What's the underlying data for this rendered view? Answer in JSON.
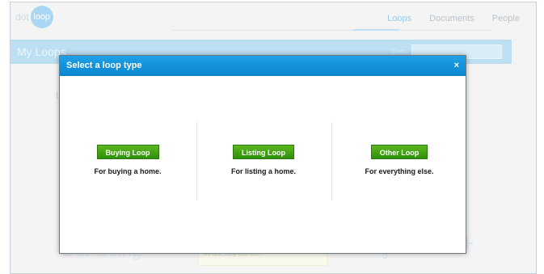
{
  "app": {
    "logo_left": "dot",
    "logo_right": "loop"
  },
  "topnav": {
    "items": [
      {
        "label": "Loops",
        "active": true
      },
      {
        "label": "Documents",
        "active": false
      },
      {
        "label": "People",
        "active": false
      }
    ]
  },
  "header": {
    "title": "My Loops",
    "view_label": "View"
  },
  "modal": {
    "title": "Select a loop type",
    "close_label": "×",
    "options": [
      {
        "button": "Buying Loop",
        "description": "For buying a home."
      },
      {
        "button": "Listing Loop",
        "description": "For listing a home."
      },
      {
        "button": "Other Loop",
        "description": "For everything else."
      }
    ]
  },
  "background": {
    "box_text": "It's fast, easy and free!",
    "plus": "+"
  },
  "colors": {
    "modal_header": "#1ea0e6",
    "button_green": "#3f9f14",
    "header_bar": "#bcdff3"
  }
}
